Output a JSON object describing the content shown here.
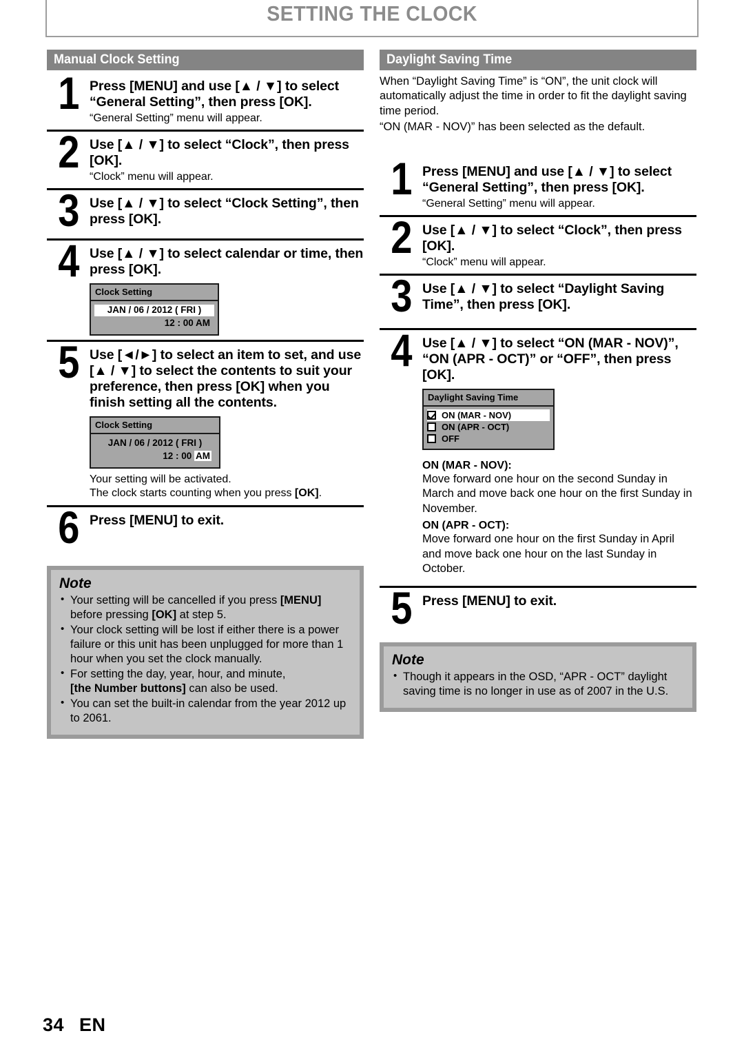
{
  "page": {
    "title": "SETTING THE CLOCK",
    "footer_page_number": "34",
    "footer_language": "EN"
  },
  "left_column": {
    "section_title": "Manual Clock Setting",
    "steps": [
      {
        "number": "1",
        "title": "Press [MENU] and use [▲ / ▼] to select “General Setting”, then press [OK].",
        "sub": "“General Setting” menu will appear."
      },
      {
        "number": "2",
        "title": "Use [▲ / ▼] to select “Clock”, then press [OK].",
        "sub": "“Clock” menu will appear."
      },
      {
        "number": "3",
        "title": "Use [▲ / ▼] to select “Clock Setting”, then press [OK]."
      },
      {
        "number": "4",
        "title": "Use [▲ / ▼] to select calendar or time, then press [OK]."
      },
      {
        "number": "5",
        "title": "Use [◄/►] to select an item to set, and use [▲ / ▼] to select the contents to suit your preference, then press [OK] when you finish setting all the contents.",
        "after_line1": "Your setting will be activated.",
        "after_line2_a": "The clock starts counting when you press ",
        "after_line2_b": "[OK]",
        "after_line2_c": "."
      },
      {
        "number": "6",
        "title": "Press [MENU] to exit."
      }
    ],
    "osd_step4": {
      "header": "Clock Setting",
      "date_line": "JAN / 06 / 2012 ( FRI )",
      "time_line": "12 : 00 AM"
    },
    "osd_step5": {
      "header": "Clock Setting",
      "date_line": "JAN / 06 / 2012 ( FRI )",
      "time_value": "12 : 00 ",
      "time_meridiem": "AM"
    },
    "note": {
      "title": "Note",
      "items": [
        {
          "a": "Your setting will be cancelled if you press ",
          "b": "[MENU]",
          "c": " before pressing ",
          "d": "[OK]",
          "e": " at step 5."
        },
        {
          "a": "Your clock setting will be lost if either there is a power failure or this unit has been unplugged for more than 1 hour when you set the clock manually."
        },
        {
          "a": "For setting the day, year, hour, and minute, ",
          "b": "[the Number buttons]",
          "c": " can also be used."
        },
        {
          "a": "You can set the built-in calendar from the year 2012 up to 2061."
        }
      ]
    }
  },
  "right_column": {
    "section_title": "Daylight Saving Time",
    "intro_paragraph": "When “Daylight Saving Time” is “ON”, the unit clock will automatically adjust the time in order to fit the daylight saving time period.",
    "intro_default": "“ON (MAR - NOV)” has been selected as the default.",
    "steps": [
      {
        "number": "1",
        "title": "Press [MENU] and use [▲ / ▼] to select “General Setting”, then press [OK].",
        "sub": "“General Setting” menu will appear."
      },
      {
        "number": "2",
        "title": "Use [▲ / ▼] to select “Clock”, then press [OK].",
        "sub": "“Clock” menu will appear."
      },
      {
        "number": "3",
        "title": "Use [▲ / ▼] to select “Daylight Saving Time”, then press [OK]."
      },
      {
        "number": "4",
        "title": "Use [▲ / ▼] to select “ON (MAR - NOV)”, “ON (APR - OCT)” or “OFF”, then press [OK]."
      },
      {
        "number": "5",
        "title": "Press [MENU] to exit."
      }
    ],
    "osd_dst": {
      "header": "Daylight Saving Time",
      "options": [
        {
          "label": "ON (MAR - NOV)",
          "checked": true
        },
        {
          "label": "ON (APR - OCT)",
          "checked": false
        },
        {
          "label": "OFF",
          "checked": false
        }
      ]
    },
    "descriptions": [
      {
        "term": "ON (MAR - NOV):",
        "text": "Move forward one hour on the second Sunday in March and move back one hour on the first Sunday in November."
      },
      {
        "term": "ON (APR - OCT):",
        "text": "Move forward one hour on the first Sunday in April and move back one hour on the last Sunday in October."
      }
    ],
    "note": {
      "title": "Note",
      "items": [
        {
          "a": "Though it appears in the OSD, “APR - OCT” daylight saving time is no longer in use as of 2007 in the U.S."
        }
      ]
    }
  }
}
